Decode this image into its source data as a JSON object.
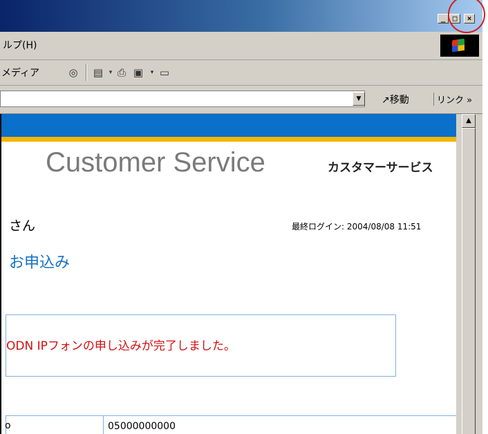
{
  "window": {
    "minimize_glyph": "_",
    "maximize_glyph": "□",
    "close_glyph": "×"
  },
  "menubar": {
    "help_label": "ルプ(H)"
  },
  "toolbar": {
    "media_label": "メディア",
    "icons": [
      "history-icon",
      "print-preview-icon",
      "print-icon",
      "word-icon",
      "edit-icon"
    ]
  },
  "addressbar": {
    "go_label": "移動",
    "links_label": "リンク »"
  },
  "page": {
    "logo_en": "Customer Service",
    "logo_jp": "カスタマーサービス",
    "user_suffix": "さん",
    "last_login": "最終ログイン: 2004/08/08 11:51",
    "heading": "お申込み",
    "message": "ODN IPフォンの申し込みが完了しました。",
    "table": {
      "row1_label": "o",
      "row1_value": "05000000000"
    }
  },
  "colors": {
    "brand_blue": "#0a70c9",
    "brand_yellow": "#f4b400",
    "message_red": "#d01010",
    "annotation_red": "#d21f1f"
  }
}
